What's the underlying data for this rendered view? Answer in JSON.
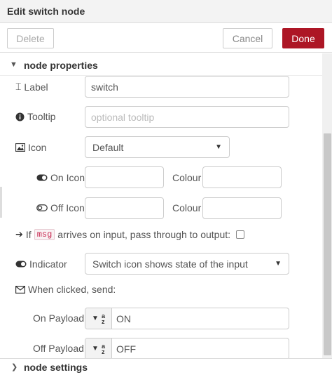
{
  "header": {
    "title": "Edit switch node"
  },
  "toolbar": {
    "delete_label": "Delete",
    "cancel_label": "Cancel",
    "done_label": "Done"
  },
  "sections": {
    "properties_label": "node properties",
    "settings_label": "node settings"
  },
  "form": {
    "label_label": "Label",
    "label_value": "switch",
    "tooltip_label": "Tooltip",
    "tooltip_placeholder": "optional tooltip",
    "icon_label": "Icon",
    "icon_value": "Default",
    "on_icon_label": "On Icon",
    "on_colour_label": "Colour",
    "off_icon_label": "Off Icon",
    "off_colour_label": "Colour",
    "if_prefix": "If",
    "msg_code": "msg",
    "passthrough_text": "arrives on input, pass through to output:",
    "indicator_label": "Indicator",
    "indicator_value": "Switch icon shows state of the input",
    "when_clicked_label": "When clicked, send:",
    "on_payload_label": "On Payload",
    "on_payload_value": "ON",
    "off_payload_label": "Off Payload",
    "off_payload_value": "OFF"
  },
  "colors": {
    "done": "#ad1625",
    "code": "#c7254e"
  }
}
